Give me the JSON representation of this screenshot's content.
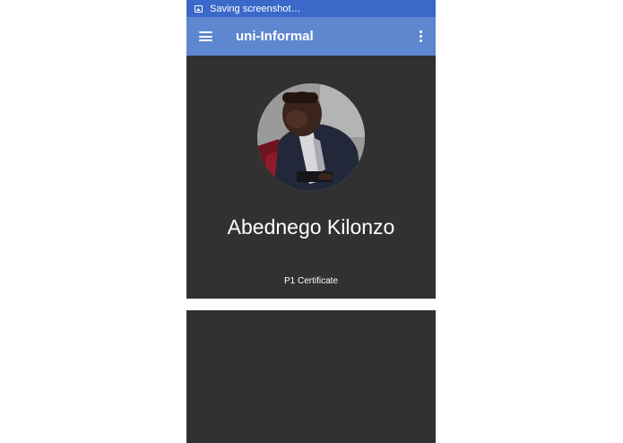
{
  "status_bar": {
    "text": "Saving screenshot…",
    "icon": "image-icon",
    "color": "#3b69c9"
  },
  "app_bar": {
    "title": "uni-Informal",
    "menu_icon": "hamburger-menu-icon",
    "overflow_icon": "more-vert-icon",
    "color": "#5e87cf"
  },
  "profile": {
    "avatar": "profile-photo",
    "name": "Abednego Kilonzo",
    "caption": "P1 Certificate",
    "card_color": "#313131"
  }
}
